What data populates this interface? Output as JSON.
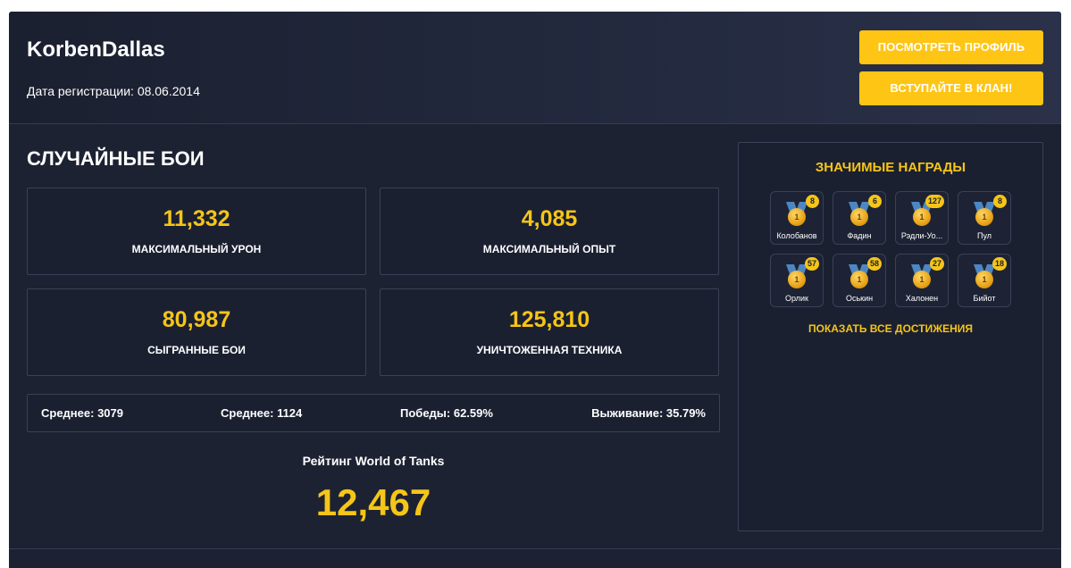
{
  "header": {
    "username": "KorbenDallas",
    "registration": "Дата регистрации: 08.06.2014",
    "view_profile_label": "ПОСМОТРЕТЬ ПРОФИЛЬ",
    "join_clan_label": "ВСТУПАЙТЕ В КЛАН!"
  },
  "random_battles": {
    "title": "СЛУЧАЙНЫЕ БОИ",
    "stats": [
      {
        "value": "11,332",
        "label": "МАКСИМАЛЬНЫЙ УРОН"
      },
      {
        "value": "4,085",
        "label": "МАКСИМАЛЬНЫЙ ОПЫТ"
      },
      {
        "value": "80,987",
        "label": "СЫГРАННЫЕ БОИ"
      },
      {
        "value": "125,810",
        "label": "УНИЧТОЖЕННАЯ ТЕХНИКА"
      }
    ],
    "averages": [
      "Среднее: 3079",
      "Среднее: 1124",
      "Победы: 62.59%",
      "Выживание: 35.79%"
    ],
    "rating_title": "Рейтинг World of Tanks",
    "rating_value": "12,467"
  },
  "awards": {
    "title": "ЗНАЧИМЫЕ НАГРАДЫ",
    "show_all_label": "ПОКАЗАТЬ ВСЕ ДОСТИЖЕНИЯ",
    "items": [
      {
        "name": "Колобанов",
        "count": "8",
        "medal_text": "1"
      },
      {
        "name": "Фадин",
        "count": "6",
        "medal_text": "1"
      },
      {
        "name": "Рэдли-Уо...",
        "count": "127",
        "medal_text": "1"
      },
      {
        "name": "Пул",
        "count": "8",
        "medal_text": "1"
      },
      {
        "name": "Орлик",
        "count": "57",
        "medal_text": "1"
      },
      {
        "name": "Оськин",
        "count": "58",
        "medal_text": "1"
      },
      {
        "name": "Халонен",
        "count": "27",
        "medal_text": "1"
      },
      {
        "name": "Бийот",
        "count": "18",
        "medal_text": "1"
      }
    ],
    "medal_color": "#e8a318",
    "ribbon_color": "#4c87c4"
  },
  "colors": {
    "accent": "#f5c518",
    "button": "#ffc515",
    "background": "#1d2232"
  }
}
